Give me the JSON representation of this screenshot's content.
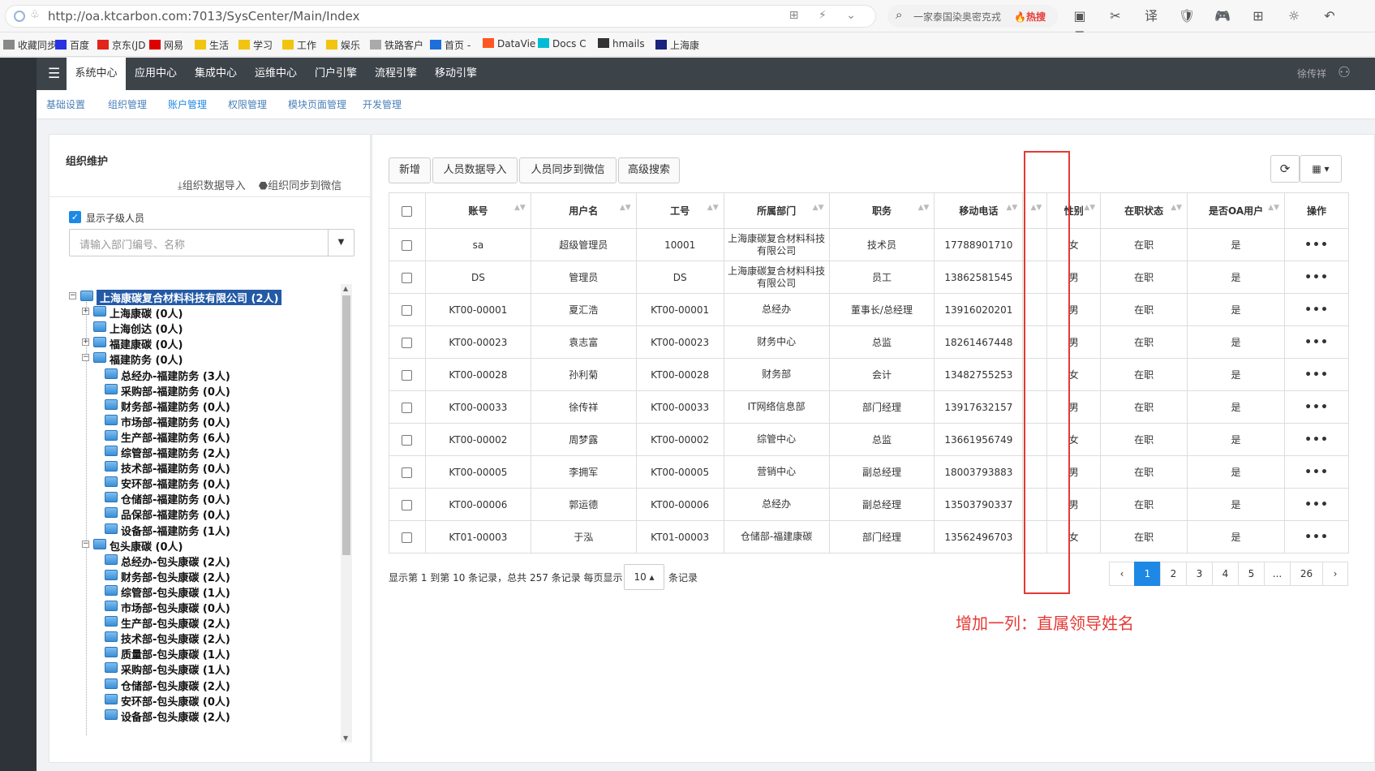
{
  "browser": {
    "url": "http://oa.ktcarbon.com:7013/SysCenter/Main/Index",
    "url_tools": "⊞ ⚡ ⌄",
    "search_text": "一家泰国染奥密克戎",
    "search_hot": "🔥热搜",
    "extensions": [
      "▣",
      "✂",
      "译",
      "🛡",
      "🎮",
      "⊞",
      "☼",
      "↶",
      "≡"
    ],
    "bookmarks": [
      {
        "label": "收藏同步",
        "icon_color": "#888"
      },
      {
        "label": "百度",
        "icon_color": "#2932e1"
      },
      {
        "label": "京东(JD",
        "icon_color": "#e1251b"
      },
      {
        "label": "网易",
        "icon_color": "#d00"
      },
      {
        "label": "生活",
        "icon_color": "#f1c40f"
      },
      {
        "label": "学习",
        "icon_color": "#f1c40f"
      },
      {
        "label": "工作",
        "icon_color": "#f1c40f"
      },
      {
        "label": "娱乐",
        "icon_color": "#f1c40f"
      },
      {
        "label": "铁路客户",
        "icon_color": "#aaa"
      },
      {
        "label": "首页 -",
        "icon_color": "#1e6fd9"
      },
      {
        "label": "DataVie",
        "icon_color": "#ff5722"
      },
      {
        "label": "Docs C",
        "icon_color": "#00bcd4"
      },
      {
        "label": "hmails",
        "icon_color": "#333"
      },
      {
        "label": "上海康",
        "icon_color": "#1a237e"
      }
    ]
  },
  "nav": {
    "menu_icon": "☰",
    "tabs": [
      "系统中心",
      "应用中心",
      "集成中心",
      "运维中心",
      "门户引擎",
      "流程引擎",
      "移动引擎"
    ],
    "user": "徐传祥",
    "user_icon": "⚇"
  },
  "subnav": {
    "tabs": [
      "基础设置",
      "组织管理",
      "账户管理",
      "权限管理",
      "模块页面管理",
      "开发管理"
    ]
  },
  "left_panel": {
    "title": "组织维护",
    "import_label": "⤓组织数据导入",
    "sync_label": "⬣组织同步到微信",
    "show_sub_label": "显示子级人员",
    "check_mark": "✓",
    "select_placeholder": "请输入部门编号、名称",
    "select_arrow": "▼",
    "tree": [
      {
        "label": "上海康碳复合材料科技有限公司 (2人)",
        "level": 0,
        "exp": "−",
        "selected": true
      },
      {
        "label": "上海康碳 (0人)",
        "level": 1,
        "exp": "+"
      },
      {
        "label": "上海创达 (0人)",
        "level": 1,
        "exp": ""
      },
      {
        "label": "福建康碳 (0人)",
        "level": 1,
        "exp": "+"
      },
      {
        "label": "福建防务 (0人)",
        "level": 1,
        "exp": "−"
      },
      {
        "label": "总经办-福建防务 (3人)",
        "level": 2,
        "exp": ""
      },
      {
        "label": "采购部-福建防务 (0人)",
        "level": 2,
        "exp": ""
      },
      {
        "label": "财务部-福建防务 (0人)",
        "level": 2,
        "exp": ""
      },
      {
        "label": "市场部-福建防务 (0人)",
        "level": 2,
        "exp": ""
      },
      {
        "label": "生产部-福建防务 (6人)",
        "level": 2,
        "exp": ""
      },
      {
        "label": "综管部-福建防务 (2人)",
        "level": 2,
        "exp": ""
      },
      {
        "label": "技术部-福建防务 (0人)",
        "level": 2,
        "exp": ""
      },
      {
        "label": "安环部-福建防务 (0人)",
        "level": 2,
        "exp": ""
      },
      {
        "label": "仓储部-福建防务 (0人)",
        "level": 2,
        "exp": ""
      },
      {
        "label": "品保部-福建防务 (0人)",
        "level": 2,
        "exp": ""
      },
      {
        "label": "设备部-福建防务 (1人)",
        "level": 2,
        "exp": ""
      },
      {
        "label": "包头康碳 (0人)",
        "level": 1,
        "exp": "−"
      },
      {
        "label": "总经办-包头康碳 (2人)",
        "level": 2,
        "exp": ""
      },
      {
        "label": "财务部-包头康碳 (2人)",
        "level": 2,
        "exp": ""
      },
      {
        "label": "综管部-包头康碳 (1人)",
        "level": 2,
        "exp": ""
      },
      {
        "label": "市场部-包头康碳 (0人)",
        "level": 2,
        "exp": ""
      },
      {
        "label": "生产部-包头康碳 (2人)",
        "level": 2,
        "exp": ""
      },
      {
        "label": "技术部-包头康碳 (2人)",
        "level": 2,
        "exp": ""
      },
      {
        "label": "质量部-包头康碳 (1人)",
        "level": 2,
        "exp": ""
      },
      {
        "label": "采购部-包头康碳 (1人)",
        "level": 2,
        "exp": ""
      },
      {
        "label": "仓储部-包头康碳 (2人)",
        "level": 2,
        "exp": ""
      },
      {
        "label": "安环部-包头康碳 (0人)",
        "level": 2,
        "exp": ""
      },
      {
        "label": "设备部-包头康碳 (2人)",
        "level": 2,
        "exp": ""
      }
    ],
    "scroll_up": "▲",
    "scroll_down": "▼"
  },
  "toolbar": {
    "buttons": [
      "新增",
      "人员数据导入",
      "人员同步到微信",
      "高级搜索"
    ],
    "refresh_icon": "⟳",
    "columns_icon": "▦ ▾"
  },
  "table": {
    "columns": [
      "账号",
      "用户名",
      "工号",
      "所属部门",
      "职务",
      "移动电话",
      "",
      "性别",
      "在职状态",
      "是否OA用户",
      "操作"
    ],
    "sort_icon": "▲▼",
    "rows": [
      [
        "sa",
        "超级管理员",
        "10001",
        "上海康碳复合材料科技有限公司",
        "技术员",
        "17788901710",
        "",
        "女",
        "在职",
        "是",
        "•••"
      ],
      [
        "DS",
        "管理员",
        "DS",
        "上海康碳复合材料科技有限公司",
        "员工",
        "13862581545",
        "",
        "男",
        "在职",
        "是",
        "•••"
      ],
      [
        "KT00-00001",
        "夏汇浩",
        "KT00-00001",
        "总经办",
        "董事长/总经理",
        "13916020201",
        "",
        "男",
        "在职",
        "是",
        "•••"
      ],
      [
        "KT00-00023",
        "袁志富",
        "KT00-00023",
        "财务中心",
        "总监",
        "18261467448",
        "",
        "男",
        "在职",
        "是",
        "•••"
      ],
      [
        "KT00-00028",
        "孙利菊",
        "KT00-00028",
        "财务部",
        "会计",
        "13482755253",
        "",
        "女",
        "在职",
        "是",
        "•••"
      ],
      [
        "KT00-00033",
        "徐传祥",
        "KT00-00033",
        "IT网络信息部",
        "部门经理",
        "13917632157",
        "",
        "男",
        "在职",
        "是",
        "•••"
      ],
      [
        "KT00-00002",
        "周梦露",
        "KT00-00002",
        "综管中心",
        "总监",
        "13661956749",
        "",
        "女",
        "在职",
        "是",
        "•••"
      ],
      [
        "KT00-00005",
        "李拥军",
        "KT00-00005",
        "营销中心",
        "副总经理",
        "18003793883",
        "",
        "男",
        "在职",
        "是",
        "•••"
      ],
      [
        "KT00-00006",
        "郭运德",
        "KT00-00006",
        "总经办",
        "副总经理",
        "13503790337",
        "",
        "男",
        "在职",
        "是",
        "•••"
      ],
      [
        "KT01-00003",
        "于泓",
        "KT01-00003",
        "仓储部-福建康碳",
        "部门经理",
        "13562496703",
        "",
        "女",
        "在职",
        "是",
        "•••"
      ]
    ]
  },
  "footer": {
    "info": "显示第 1 到第 10 条记录，总共 257 条记录 每页显示",
    "page_size": "10 ▴",
    "info_suffix": "条记录",
    "pages": [
      "‹",
      "1",
      "2",
      "3",
      "4",
      "5",
      "...",
      "26",
      "›"
    ],
    "active_page": "1"
  },
  "annotation": {
    "text": "增加一列：直属领导姓名",
    "color": "#e53935"
  }
}
